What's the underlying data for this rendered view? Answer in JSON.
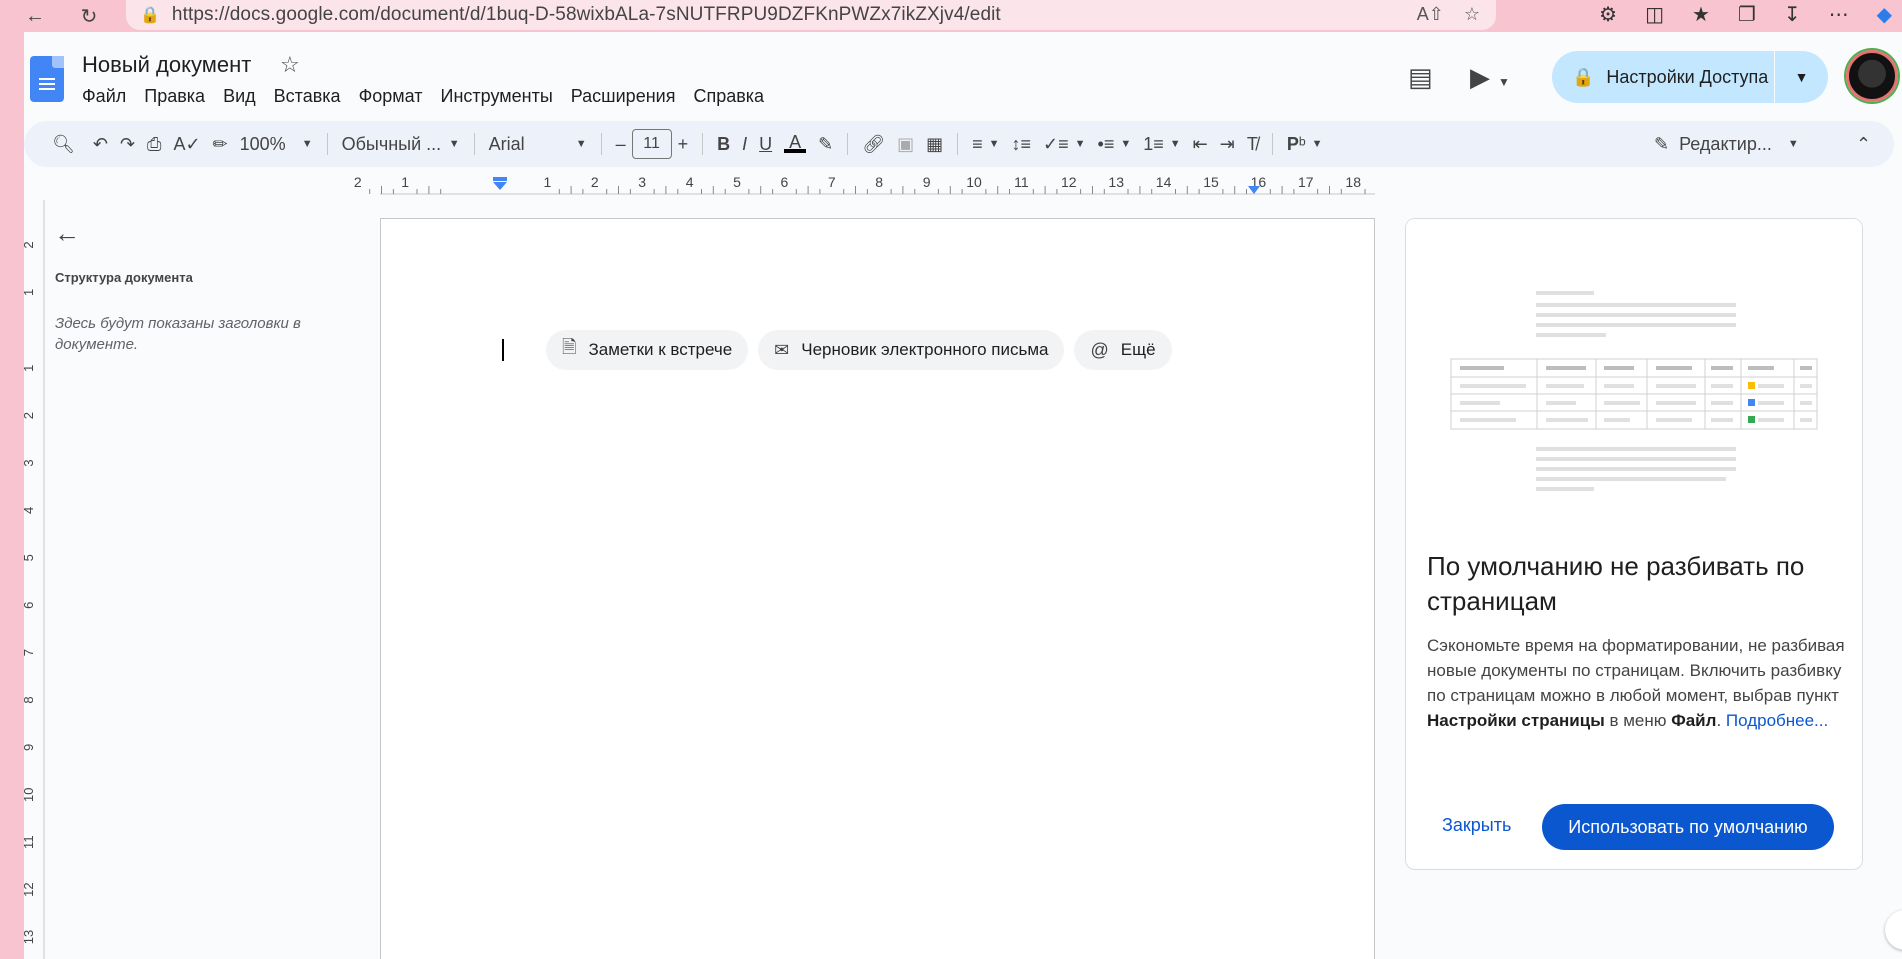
{
  "browser": {
    "url": "https://docs.google.com/document/d/1buq-D-58wixbALa-7sNUTFRPU9DZFKnPWZx7ikZXjv4/edit"
  },
  "header": {
    "title": "Новый документ",
    "menu": [
      "Файл",
      "Правка",
      "Вид",
      "Вставка",
      "Формат",
      "Инструменты",
      "Расширения",
      "Справка"
    ],
    "share_label": "Настройки Доступа"
  },
  "toolbar": {
    "zoom": "100%",
    "style": "Обычный ...",
    "font": "Arial",
    "font_size": "11",
    "mode": "Редактир..."
  },
  "ruler": {
    "top_labels": [
      "2",
      "1",
      "1",
      "2",
      "3",
      "4",
      "5",
      "6",
      "7",
      "8",
      "9",
      "10",
      "11",
      "12",
      "13",
      "14",
      "15",
      "16",
      "17",
      "18"
    ],
    "side_labels": [
      "2",
      "1",
      "1",
      "2",
      "3",
      "4",
      "5",
      "6",
      "7",
      "8",
      "9",
      "10",
      "11",
      "12",
      "13"
    ]
  },
  "outline": {
    "title": "Структура документа",
    "hint": "Здесь будут показаны заголовки в документе."
  },
  "chips": [
    {
      "icon": "document-icon",
      "label": "Заметки к встрече"
    },
    {
      "icon": "mail-icon",
      "label": "Черновик электронного письма"
    },
    {
      "icon": "at-icon",
      "label": "Ещё"
    }
  ],
  "card": {
    "title": "По умолчанию не разбивать по страницам",
    "body_1": "Сэкономьте время на форматировании, не разбивая новые документы по страницам. Включить разбивку по страницам можно в любой момент, выбрав пункт ",
    "body_bold_1": "Настройки страницы",
    "body_2": " в меню ",
    "body_bold_2": "Файл",
    "body_3": ". ",
    "body_link": "Подробнее...",
    "close_label": "Закрыть",
    "default_label": "Использовать по умолчанию"
  },
  "colors": {
    "browser_bg": "#f7c4cf",
    "accent": "#0b57d0",
    "share_bg": "#c2e7ff",
    "toolbar_bg": "#edf2fa"
  }
}
